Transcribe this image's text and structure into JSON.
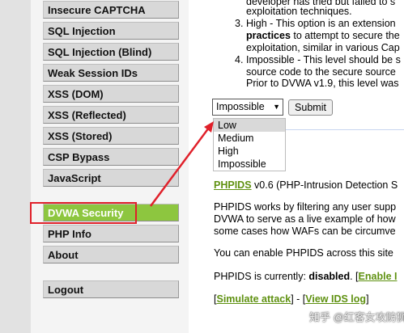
{
  "sidebar": {
    "items": [
      {
        "label": "Insecure CAPTCHA"
      },
      {
        "label": "SQL Injection"
      },
      {
        "label": "SQL Injection (Blind)"
      },
      {
        "label": "Weak Session IDs"
      },
      {
        "label": "XSS (DOM)"
      },
      {
        "label": "XSS (Reflected)"
      },
      {
        "label": "XSS (Stored)"
      },
      {
        "label": "CSP Bypass"
      },
      {
        "label": "JavaScript"
      },
      {
        "label": "DVWA Security"
      },
      {
        "label": "PHP Info"
      },
      {
        "label": "About"
      },
      {
        "label": "Logout"
      }
    ]
  },
  "levels": {
    "line0": "developer has tried but failed to s",
    "line1": "exploitation techniques.",
    "item3_num": "3.",
    "item3_line1": "High - This option is an extension",
    "item3_line2_bold": "practices",
    "item3_line2_rest": " to attempt to secure the",
    "item3_line3": "exploitation, similar in various Cap",
    "item4_num": "4.",
    "item4_line1": "Impossible - This level should be s",
    "item4_line2": "source code to the secure source",
    "item4_line3": "Prior to DVWA v1.9, this level was"
  },
  "form": {
    "selected_level": "Impossible",
    "submit_label": "Submit",
    "options": [
      "Low",
      "Medium",
      "High",
      "Impossible"
    ]
  },
  "phpids": {
    "link": "PHPIDS",
    "title_rest": " v0.6 (PHP-Intrusion Detection S",
    "desc1": "PHPIDS works by filtering any user supp",
    "desc2": "DVWA to serve as a live example of how",
    "desc3": "some cases how WAFs can be circumve",
    "enable_line": "You can enable PHPIDS across this site",
    "status_prefix": "PHPIDS is currently: ",
    "status_value": "disabled",
    "status_suffix": ". [",
    "enable_link": "Enable I",
    "bracket_open": "[",
    "simulate_link": "Simulate attack",
    "sep": "] - [",
    "view_log_link": "View IDS log",
    "bracket_close": "]"
  },
  "watermark": "知乎 @红客女攻防狮",
  "colors": {
    "accent_green": "#8dc63f",
    "link_green": "#5f9111",
    "annotation_red": "#e0202a"
  }
}
